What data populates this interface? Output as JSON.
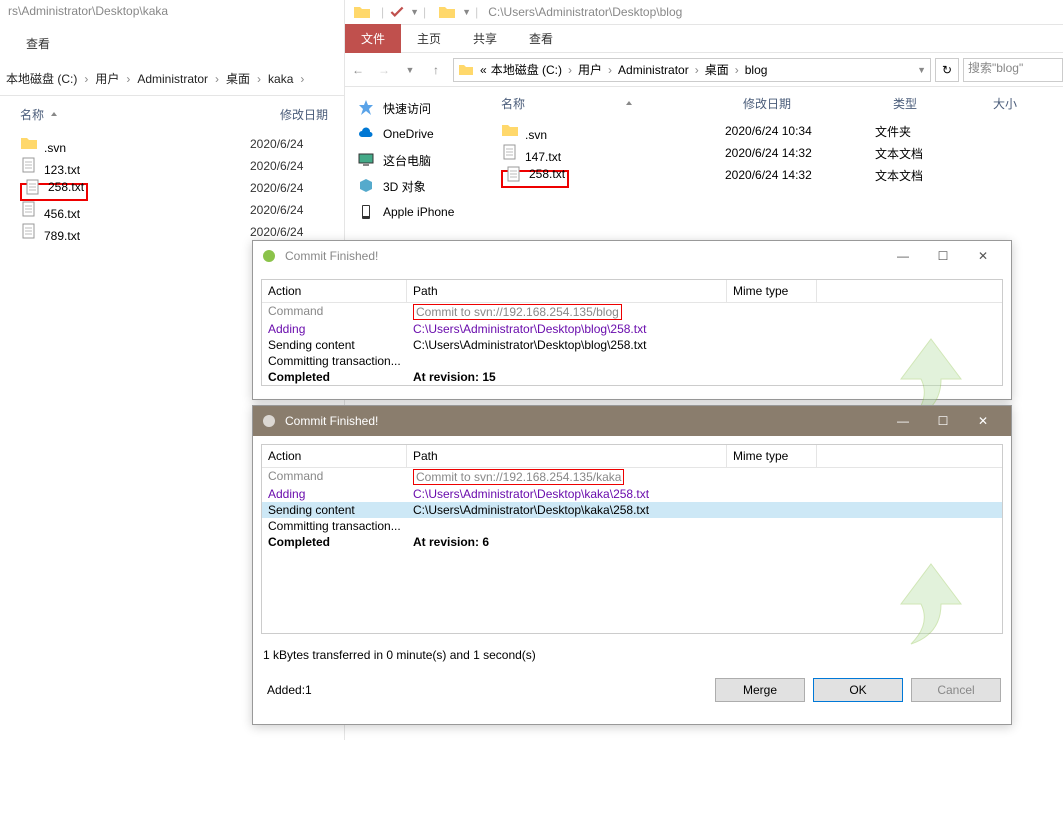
{
  "left_explorer": {
    "title": "rs\\Administrator\\Desktop\\kaka",
    "view_menu": "查看",
    "breadcrumb": [
      "本地磁盘 (C:)",
      "用户",
      "Administrator",
      "桌面",
      "kaka"
    ],
    "col_name": "名称",
    "col_date": "修改日期",
    "files": [
      {
        "name": ".svn",
        "date": "2020/6/24",
        "type": "folder"
      },
      {
        "name": "123.txt",
        "date": "2020/6/24",
        "type": "file"
      },
      {
        "name": "258.txt",
        "date": "2020/6/24",
        "type": "file",
        "highlight": true
      },
      {
        "name": "456.txt",
        "date": "2020/6/24",
        "type": "file"
      },
      {
        "name": "789.txt",
        "date": "2020/6/24",
        "type": "file"
      }
    ]
  },
  "right_explorer": {
    "title_path": "C:\\Users\\Administrator\\Desktop\\blog",
    "dropdown": "▼",
    "ribbon": {
      "file": "文件",
      "home": "主页",
      "share": "共享",
      "view": "查看"
    },
    "breadcrumb": [
      "«",
      "本地磁盘 (C:)",
      "用户",
      "Administrator",
      "桌面",
      "blog"
    ],
    "search_placeholder": "搜索\"blog\"",
    "sidebar": [
      {
        "label": "快速访问",
        "icon": "star"
      },
      {
        "label": "OneDrive",
        "icon": "cloud"
      },
      {
        "label": "这台电脑",
        "icon": "pc"
      },
      {
        "label": "3D 对象",
        "icon": "cube"
      },
      {
        "label": "Apple iPhone",
        "icon": "phone"
      }
    ],
    "columns": {
      "name": "名称",
      "date": "修改日期",
      "type": "类型",
      "size": "大小"
    },
    "files": [
      {
        "name": ".svn",
        "date": "2020/6/24 10:34",
        "ftype": "文件夹",
        "type": "folder"
      },
      {
        "name": "147.txt",
        "date": "2020/6/24 14:32",
        "ftype": "文本文档",
        "type": "file"
      },
      {
        "name": "258.txt",
        "date": "2020/6/24 14:32",
        "ftype": "文本文档",
        "type": "file",
        "highlight": true
      }
    ]
  },
  "dialog1": {
    "title": "Commit Finished!",
    "th": {
      "action": "Action",
      "path": "Path",
      "mime": "Mime type"
    },
    "rows": [
      {
        "action": "Command",
        "path": "Commit to svn://192.168.254.135/blog",
        "cls": "gray",
        "highlight": true
      },
      {
        "action": "Adding",
        "path": "C:\\Users\\Administrator\\Desktop\\blog\\258.txt",
        "cls": "purple"
      },
      {
        "action": "Sending content",
        "path": "C:\\Users\\Administrator\\Desktop\\blog\\258.txt",
        "cls": ""
      },
      {
        "action": "Committing transaction...",
        "path": "",
        "cls": ""
      },
      {
        "action": "Completed",
        "path": "At revision: 15",
        "cls": "bold"
      }
    ]
  },
  "dialog2": {
    "title": "Commit Finished!",
    "th": {
      "action": "Action",
      "path": "Path",
      "mime": "Mime type"
    },
    "rows": [
      {
        "action": "Command",
        "path": "Commit to svn://192.168.254.135/kaka",
        "cls": "gray",
        "highlight": true
      },
      {
        "action": "Adding",
        "path": "C:\\Users\\Administrator\\Desktop\\kaka\\258.txt",
        "cls": "purple"
      },
      {
        "action": "Sending content",
        "path": "C:\\Users\\Administrator\\Desktop\\kaka\\258.txt",
        "cls": "selected"
      },
      {
        "action": "Committing transaction...",
        "path": "",
        "cls": ""
      },
      {
        "action": "Completed",
        "path": "At revision: 6",
        "cls": "bold"
      }
    ],
    "status": "1 kBytes transferred in 0 minute(s) and 1 second(s)",
    "added": "Added:1",
    "buttons": {
      "merge": "Merge",
      "ok": "OK",
      "cancel": "Cancel"
    }
  }
}
